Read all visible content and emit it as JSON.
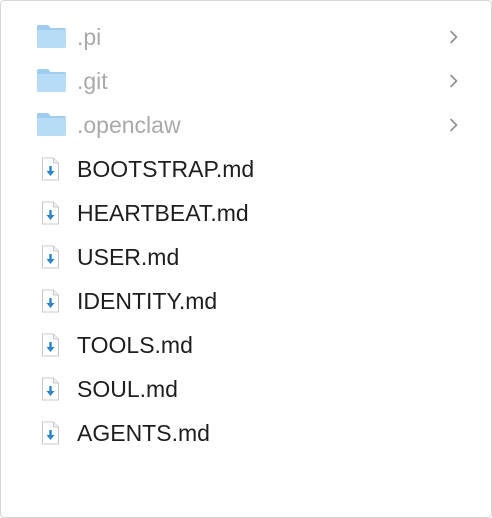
{
  "colors": {
    "folder_text": "#a9a9a9",
    "file_text": "#1e1e1e",
    "folder_fill": "#b8dcf6",
    "folder_tab": "#9fcdf0",
    "download_arrow": "#2b84c7",
    "chevron": "#8e8e8e"
  },
  "items": [
    {
      "kind": "folder",
      "name": ".pi",
      "icon": "folder-icon",
      "expand_icon": "chevron-right-icon"
    },
    {
      "kind": "folder",
      "name": ".git",
      "icon": "folder-icon",
      "expand_icon": "chevron-right-icon"
    },
    {
      "kind": "folder",
      "name": ".openclaw",
      "icon": "folder-icon",
      "expand_icon": "chevron-right-icon"
    },
    {
      "kind": "file",
      "name": "BOOTSTRAP.md",
      "icon": "download-file-icon"
    },
    {
      "kind": "file",
      "name": "HEARTBEAT.md",
      "icon": "download-file-icon"
    },
    {
      "kind": "file",
      "name": "USER.md",
      "icon": "download-file-icon"
    },
    {
      "kind": "file",
      "name": "IDENTITY.md",
      "icon": "download-file-icon"
    },
    {
      "kind": "file",
      "name": "TOOLS.md",
      "icon": "download-file-icon"
    },
    {
      "kind": "file",
      "name": "SOUL.md",
      "icon": "download-file-icon"
    },
    {
      "kind": "file",
      "name": "AGENTS.md",
      "icon": "download-file-icon"
    }
  ]
}
